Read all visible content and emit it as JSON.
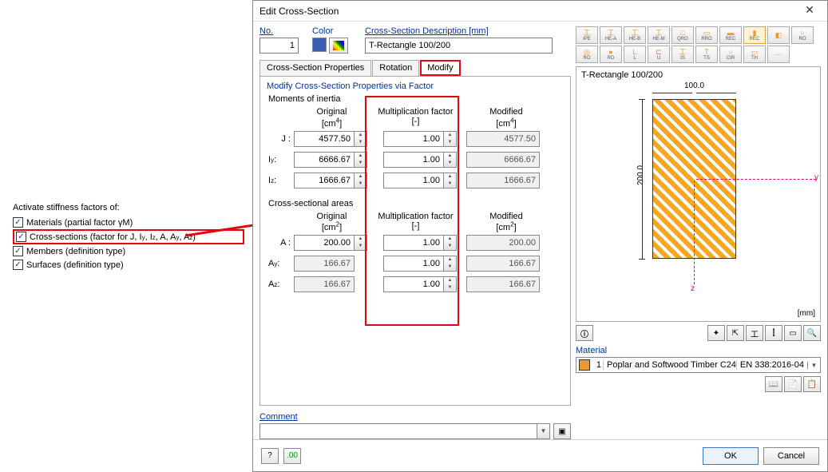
{
  "left": {
    "heading": "Activate stiffness factors of:",
    "items": [
      {
        "label": "Materials (partial factor γM)"
      },
      {
        "label": "Cross-sections (factor for J, Iy, Iz, A, Ay, Az)"
      },
      {
        "label": "Members (definition type)"
      },
      {
        "label": "Surfaces (definition type)"
      }
    ]
  },
  "dialog": {
    "title": "Edit Cross-Section",
    "no_label": "No.",
    "no_value": "1",
    "color_label": "Color",
    "desc_label": "Cross-Section Description [mm]",
    "desc_value": "T-Rectangle 100/200",
    "tabs": {
      "props": "Cross-Section Properties",
      "rot": "Rotation",
      "mod": "Modify"
    },
    "section_title": "Modify Cross-Section Properties via Factor",
    "inertia": {
      "heading": "Moments of inertia",
      "cols": {
        "orig": "Original",
        "orig_u": "[cm4]",
        "fact": "Multiplication factor",
        "fact_u": "[-]",
        "mod": "Modified",
        "mod_u": "[cm4]"
      },
      "rows": [
        {
          "lab": "J :",
          "orig": "4577.50",
          "fact": "1.00",
          "mod": "4577.50"
        },
        {
          "lab": "Iy :",
          "orig": "6666.67",
          "fact": "1.00",
          "mod": "6666.67"
        },
        {
          "lab": "Iz :",
          "orig": "1666.67",
          "fact": "1.00",
          "mod": "1666.67"
        }
      ]
    },
    "areas": {
      "heading": "Cross-sectional areas",
      "cols": {
        "orig": "Original",
        "orig_u": "[cm2]",
        "fact": "Multiplication factor",
        "fact_u": "[-]",
        "mod": "Modified",
        "mod_u": "[cm2]"
      },
      "rows": [
        {
          "lab": "A :",
          "orig": "200.00",
          "fact": "1.00",
          "mod": "200.00"
        },
        {
          "lab": "Ay :",
          "orig": "166.67",
          "fact": "1.00",
          "mod": "166.67"
        },
        {
          "lab": "Az :",
          "orig": "166.67",
          "fact": "1.00",
          "mod": "166.67"
        }
      ]
    },
    "comment_label": "Comment",
    "preview_title": "T-Rectangle 100/200",
    "dim_w": "100.0",
    "dim_h": "200.0",
    "unit": "[mm]",
    "material_label": "Material",
    "material_num": "1",
    "material_name": "Poplar and Softwood Timber C24",
    "material_std": "EN 338:2016-04",
    "ok": "OK",
    "cancel": "Cancel",
    "profiles": [
      "IPE",
      "HE-A",
      "HE-B",
      "HE-M",
      "QRO",
      "RRO",
      "REC",
      "REC",
      "RO",
      "RO",
      "RD",
      "L",
      "U",
      "IS",
      "TS",
      "CIR",
      "TH",
      ""
    ]
  }
}
